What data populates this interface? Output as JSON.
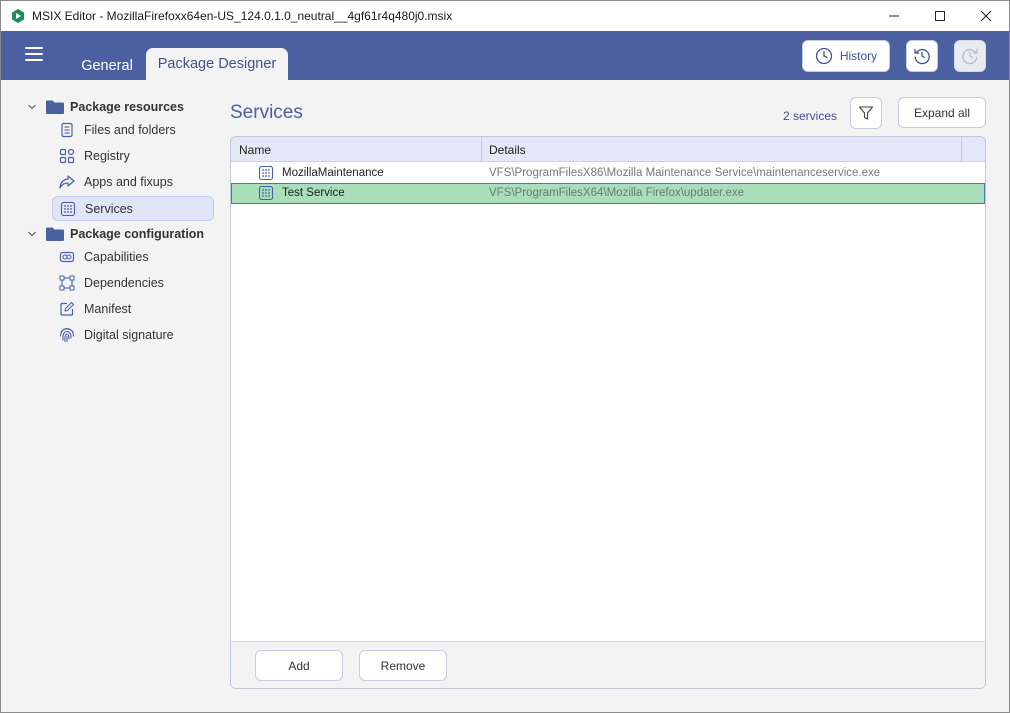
{
  "window": {
    "title": "MSIX Editor - MozillaFirefoxx64en-US_124.0.1.0_neutral__4gf61r4q480j0.msix"
  },
  "header": {
    "tabs": [
      {
        "label": "General",
        "active": false
      },
      {
        "label": "Package Designer",
        "active": true
      }
    ],
    "history_label": "History"
  },
  "sidebar": {
    "groups": [
      {
        "label": "Package resources",
        "items": [
          {
            "label": "Files and folders",
            "icon": "file-icon"
          },
          {
            "label": "Registry",
            "icon": "registry-icon"
          },
          {
            "label": "Apps and fixups",
            "icon": "share-arrow-icon"
          },
          {
            "label": "Services",
            "icon": "services-grid-icon",
            "selected": true
          }
        ]
      },
      {
        "label": "Package configuration",
        "items": [
          {
            "label": "Capabilities",
            "icon": "capabilities-icon"
          },
          {
            "label": "Dependencies",
            "icon": "dependencies-icon"
          },
          {
            "label": "Manifest",
            "icon": "manifest-edit-icon"
          },
          {
            "label": "Digital signature",
            "icon": "fingerprint-icon"
          }
        ]
      }
    ]
  },
  "main": {
    "title": "Services",
    "count_text": "2 services",
    "expand_all_label": "Expand all",
    "grid": {
      "columns": [
        "Name",
        "Details"
      ],
      "rows": [
        {
          "name": "MozillaMaintenance",
          "details": "VFS\\ProgramFilesX86\\Mozilla Maintenance Service\\maintenanceservice.exe",
          "selected": false
        },
        {
          "name": "Test Service",
          "details": "VFS\\ProgramFilesX64\\Mozilla Firefox\\updater.exe",
          "selected": true
        }
      ]
    },
    "add_label": "Add",
    "remove_label": "Remove"
  },
  "colors": {
    "header_bg": "#4a60a0",
    "accent": "#3f528f",
    "selected_row": "#a8deba",
    "selected_nav": "#dfe4f7"
  }
}
